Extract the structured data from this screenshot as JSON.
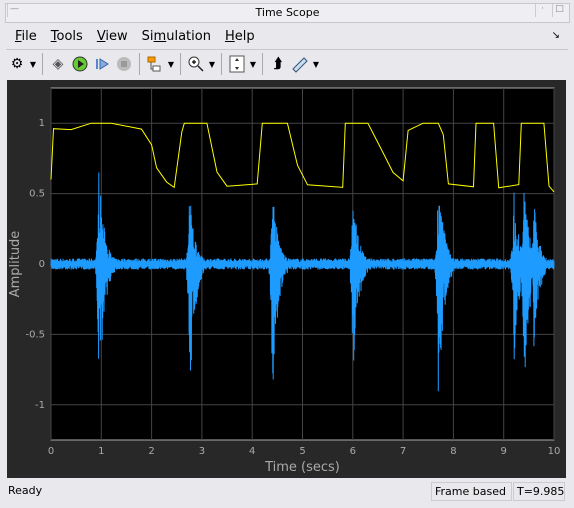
{
  "window": {
    "title": "Time Scope"
  },
  "menu": [
    {
      "pre": "",
      "u": "F",
      "post": "ile"
    },
    {
      "pre": "",
      "u": "T",
      "post": "ools"
    },
    {
      "pre": "",
      "u": "V",
      "post": "iew"
    },
    {
      "pre": "Si",
      "u": "m",
      "post": "ulation"
    },
    {
      "pre": "",
      "u": "H",
      "post": "elp"
    }
  ],
  "toolbar": [
    "settings-icon",
    "highlight-simulink-icon",
    "run-icon",
    "step-forward-icon",
    "stop-icon",
    "signal-selection-icon",
    "zoom-in-icon",
    "scale-axes-icon",
    "bring-to-front-icon",
    "measurements-icon"
  ],
  "status": {
    "left": "Ready",
    "mode": "Frame based",
    "time": "T=9.985"
  },
  "chart_data": {
    "type": "line",
    "xlabel": "Time (secs)",
    "ylabel": "Amplitude",
    "xlim": [
      0,
      10
    ],
    "ylim": [
      -1.25,
      1.25
    ],
    "xticks": [
      "0",
      "1",
      "2",
      "3",
      "4",
      "5",
      "6",
      "7",
      "8",
      "9",
      "10"
    ],
    "yticks": [
      {
        "v": 1,
        "label": "1"
      },
      {
        "v": 0.5,
        "label": "0.5"
      },
      {
        "v": 0,
        "label": "0"
      },
      {
        "v": -0.5,
        "label": "-0.5"
      },
      {
        "v": -1,
        "label": "-1"
      }
    ],
    "grid": true,
    "background": "#000000",
    "series": [
      {
        "color": "#ffff00",
        "points": [
          [
            0,
            0.6
          ],
          [
            0.05,
            0.95
          ],
          [
            0.4,
            0.97
          ],
          [
            0.8,
            1
          ],
          [
            1.2,
            1
          ],
          [
            1.8,
            0.97
          ],
          [
            2.0,
            0.85
          ],
          [
            2.1,
            0.7
          ],
          [
            2.3,
            0.6
          ],
          [
            2.45,
            0.55
          ],
          [
            2.6,
            0.95
          ],
          [
            2.65,
            1
          ],
          [
            3.1,
            1
          ],
          [
            3.3,
            0.65
          ],
          [
            3.5,
            0.55
          ],
          [
            4.1,
            0.56
          ],
          [
            4.2,
            1
          ],
          [
            4.7,
            1
          ],
          [
            4.9,
            0.7
          ],
          [
            5.1,
            0.55
          ],
          [
            5.8,
            0.55
          ],
          [
            5.85,
            1
          ],
          [
            6.3,
            1
          ],
          [
            6.6,
            0.8
          ],
          [
            6.8,
            0.65
          ],
          [
            7.0,
            0.6
          ],
          [
            7.1,
            0.95
          ],
          [
            7.4,
            1
          ],
          [
            7.7,
            1
          ],
          [
            7.8,
            0.9
          ],
          [
            7.9,
            0.55
          ],
          [
            8.4,
            0.55
          ],
          [
            8.45,
            1
          ],
          [
            8.8,
            1
          ],
          [
            8.9,
            0.55
          ],
          [
            9.3,
            0.55
          ],
          [
            9.35,
            1
          ],
          [
            9.8,
            1
          ],
          [
            9.9,
            0.55
          ],
          [
            10,
            0.52
          ]
        ]
      },
      {
        "color": "#1e9bff",
        "noise": 0.04,
        "bursts": [
          {
            "t": 0.95,
            "max": 0.7,
            "min": -1
          },
          {
            "t": 2.75,
            "max": 0.55,
            "min": -1
          },
          {
            "t": 4.4,
            "max": 0.6,
            "min": -1
          },
          {
            "t": 6.0,
            "max": 0.55,
            "min": -0.85
          },
          {
            "t": 7.7,
            "max": 0.72,
            "min": -1
          },
          {
            "t": 9.2,
            "max": 0.55,
            "min": -0.75
          },
          {
            "t": 9.4,
            "max": 0.6,
            "min": -1
          },
          {
            "t": 9.6,
            "max": 0.45,
            "min": -0.6
          }
        ]
      }
    ]
  }
}
